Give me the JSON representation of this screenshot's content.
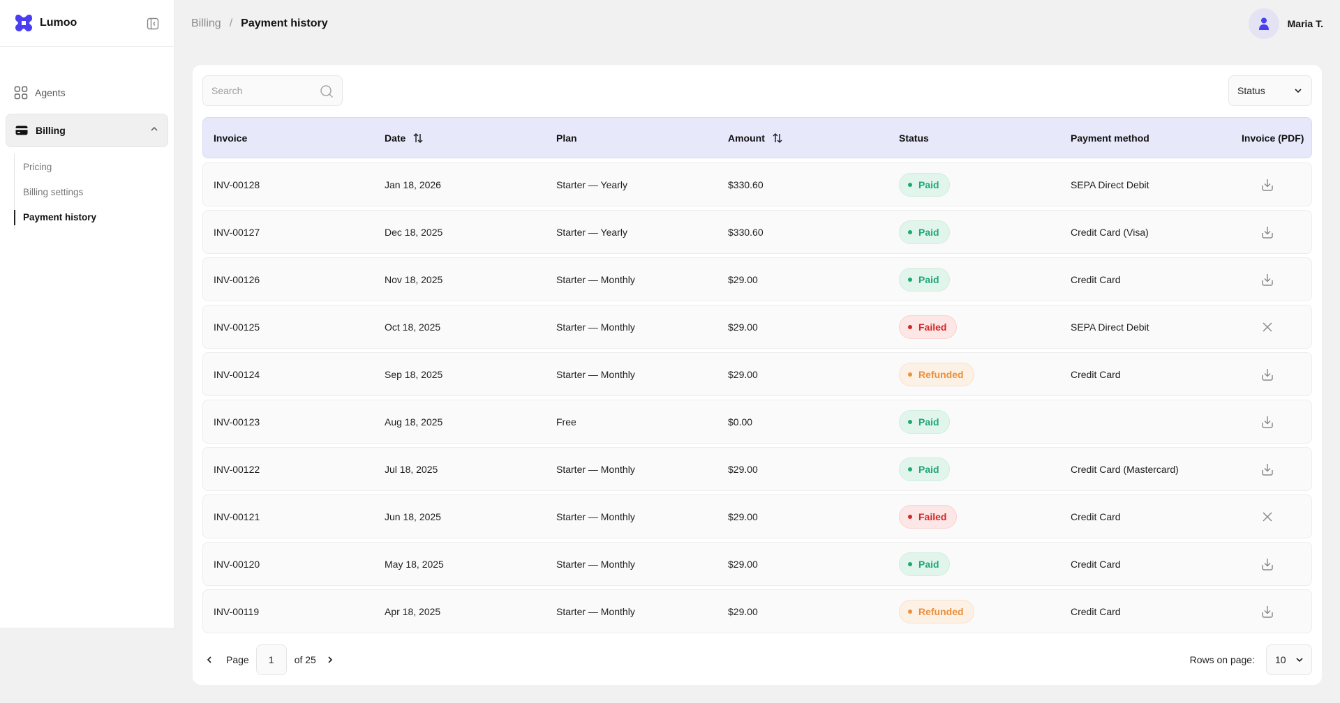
{
  "app": {
    "brand": "Lumoo",
    "accent": "#4a3df2"
  },
  "sidebar": {
    "items": [
      {
        "label": "Agents",
        "icon": "grid-icon"
      },
      {
        "label": "Billing",
        "icon": "credit-card-icon",
        "expanded": true
      }
    ],
    "billing_sub": [
      "Pricing",
      "Billing settings",
      "Payment history"
    ],
    "active_sub": "Payment history"
  },
  "header": {
    "breadcrumb_parent": "Billing",
    "breadcrumb_sep": "/",
    "breadcrumb_current": "Payment history",
    "user_name": "Maria T."
  },
  "toolbar": {
    "search_placeholder": "Search",
    "status_filter_label": "Status"
  },
  "table": {
    "columns": [
      "Invoice",
      "Date",
      "Plan",
      "Amount",
      "Status",
      "Payment method",
      "Invoice (PDF)"
    ],
    "rows": [
      {
        "invoice": "INV-00128",
        "date": "Jan 18, 2026",
        "plan": "Starter — Yearly",
        "amount": "$330.60",
        "status": "Paid",
        "method": "SEPA Direct Debit",
        "pdf": "download"
      },
      {
        "invoice": "INV-00127",
        "date": "Dec 18, 2025",
        "plan": "Starter — Yearly",
        "amount": "$330.60",
        "status": "Paid",
        "method": "Credit Card (Visa)",
        "pdf": "download"
      },
      {
        "invoice": "INV-00126",
        "date": "Nov 18, 2025",
        "plan": "Starter — Monthly",
        "amount": "$29.00",
        "status": "Paid",
        "method": "Credit Card",
        "pdf": "download"
      },
      {
        "invoice": "INV-00125",
        "date": "Oct 18, 2025",
        "plan": "Starter — Monthly",
        "amount": "$29.00",
        "status": "Failed",
        "method": "SEPA Direct Debit",
        "pdf": "unavailable"
      },
      {
        "invoice": "INV-00124",
        "date": "Sep 18, 2025",
        "plan": "Starter — Monthly",
        "amount": "$29.00",
        "status": "Refunded",
        "method": "Credit Card",
        "pdf": "download"
      },
      {
        "invoice": "INV-00123",
        "date": "Aug 18, 2025",
        "plan": "Free",
        "amount": "$0.00",
        "status": "Paid",
        "method": "",
        "pdf": "download"
      },
      {
        "invoice": "INV-00122",
        "date": "Jul 18, 2025",
        "plan": "Starter — Monthly",
        "amount": "$29.00",
        "status": "Paid",
        "method": "Credit Card (Mastercard)",
        "pdf": "download"
      },
      {
        "invoice": "INV-00121",
        "date": "Jun 18, 2025",
        "plan": "Starter — Monthly",
        "amount": "$29.00",
        "status": "Failed",
        "method": "Credit Card",
        "pdf": "unavailable"
      },
      {
        "invoice": "INV-00120",
        "date": "May 18, 2025",
        "plan": "Starter — Monthly",
        "amount": "$29.00",
        "status": "Paid",
        "method": "Credit Card",
        "pdf": "download"
      },
      {
        "invoice": "INV-00119",
        "date": "Apr 18, 2025",
        "plan": "Starter — Monthly",
        "amount": "$29.00",
        "status": "Refunded",
        "method": "Credit Card",
        "pdf": "download"
      }
    ]
  },
  "pagination": {
    "page_label": "Page",
    "current_page": "1",
    "of_label": "of 25",
    "rows_label": "Rows on page:",
    "rows_value": "10"
  }
}
